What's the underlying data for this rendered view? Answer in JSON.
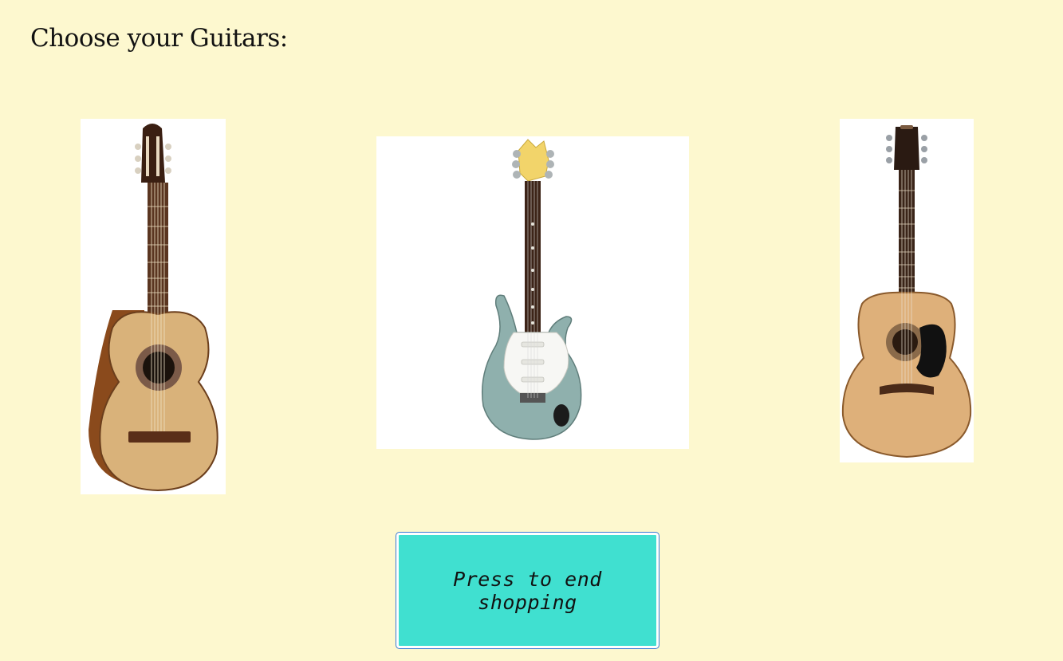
{
  "page": {
    "title": "Choose your Guitars:",
    "background_color": "#fdf8cf"
  },
  "guitars": [
    {
      "type": "classical-acoustic-guitar",
      "body_color": "#d9b27a"
    },
    {
      "type": "electric-guitar",
      "body_color": "#8fb0ad"
    },
    {
      "type": "dreadnought-acoustic-guitar",
      "body_color": "#deb07a"
    }
  ],
  "end_button": {
    "label": "Press to end shopping",
    "color": "#40e0d0"
  }
}
